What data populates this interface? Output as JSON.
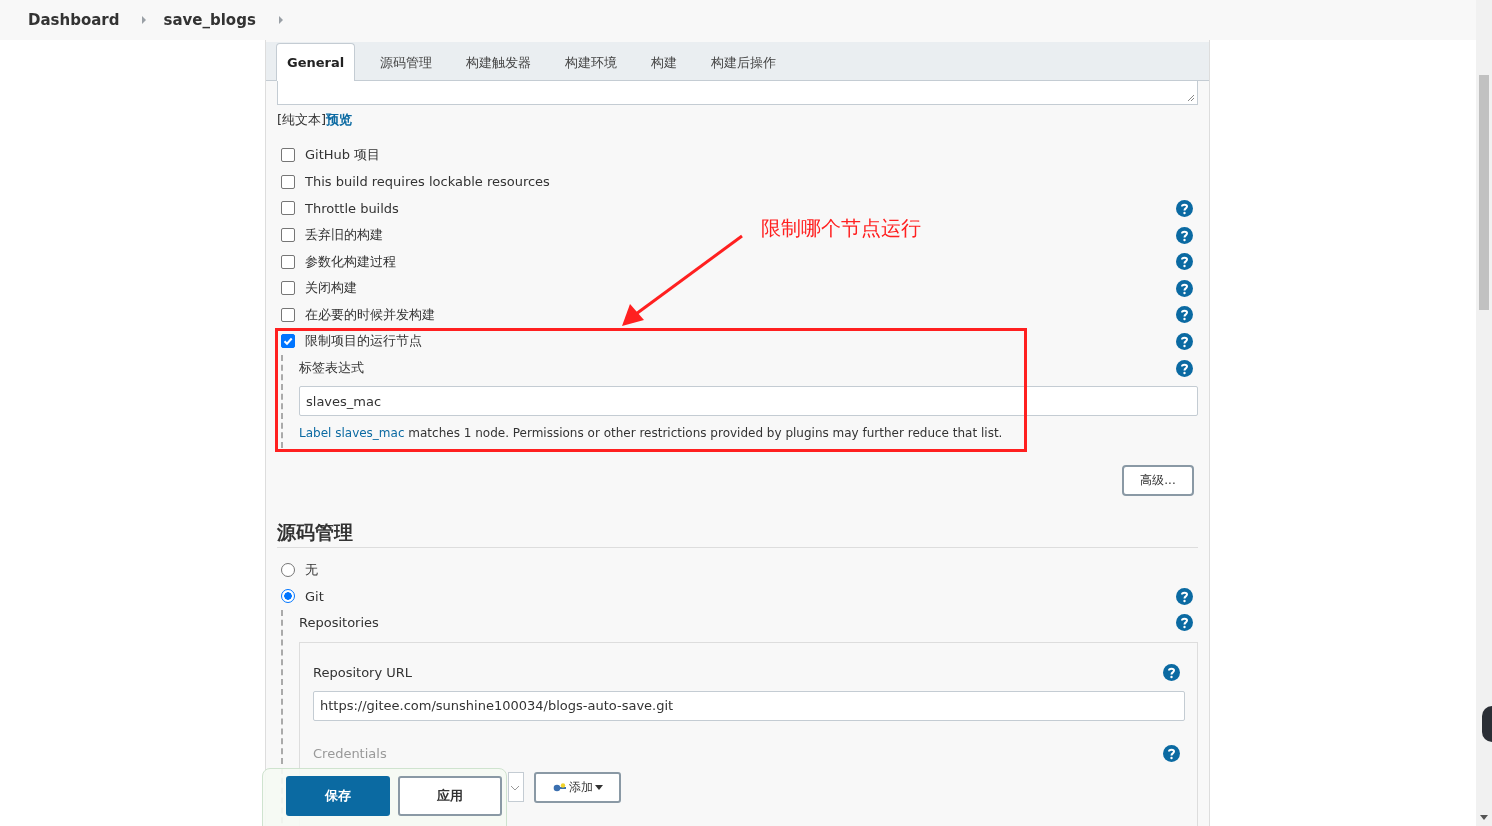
{
  "breadcrumbs": [
    {
      "label": "Dashboard"
    },
    {
      "label": "save_blogs"
    }
  ],
  "tabs": [
    {
      "label": "General",
      "selected": true
    },
    {
      "label": "源码管理",
      "selected": false
    },
    {
      "label": "构建触发器",
      "selected": false
    },
    {
      "label": "构建环境",
      "selected": false
    },
    {
      "label": "构建",
      "selected": false
    },
    {
      "label": "构建后操作",
      "selected": false
    }
  ],
  "description_format": {
    "label": "[纯文本]",
    "link": "预览"
  },
  "options": [
    {
      "label": "GitHub 项目",
      "checked": false,
      "help": false
    },
    {
      "label": "This build requires lockable resources",
      "checked": false,
      "help": false
    },
    {
      "label": "Throttle builds",
      "checked": false,
      "help": true
    },
    {
      "label": "丢弃旧的构建",
      "checked": false,
      "help": true
    },
    {
      "label": "参数化构建过程",
      "checked": false,
      "help": true
    },
    {
      "label": "关闭构建",
      "checked": false,
      "help": true
    },
    {
      "label": "在必要的时候并发构建",
      "checked": false,
      "help": true
    },
    {
      "label": "限制项目的运行节点",
      "checked": true,
      "help": true
    }
  ],
  "label_expression": {
    "label": "标签表达式",
    "value": "slaves_mac",
    "link": "Label slaves_mac",
    "message": "matches 1 node. Permissions or other restrictions provided by plugins may further reduce that list."
  },
  "advanced_button": "高级...",
  "scm": {
    "title": "源码管理",
    "options": [
      {
        "label": "无",
        "selected": false,
        "help": false
      },
      {
        "label": "Git",
        "selected": true,
        "help": true
      }
    ],
    "repositories_label": "Repositories",
    "repository_url_label": "Repository URL",
    "repository_url": "https://gitee.com/sunshine100034/blogs-auto-save.git",
    "credentials_label": "Credentials",
    "add_button": "添加"
  },
  "footer_buttons": [
    {
      "label": "保存",
      "kind": "primary"
    },
    {
      "label": "应用",
      "kind": "secondary"
    }
  ],
  "annotation": {
    "text": "限制哪个节点运行"
  }
}
